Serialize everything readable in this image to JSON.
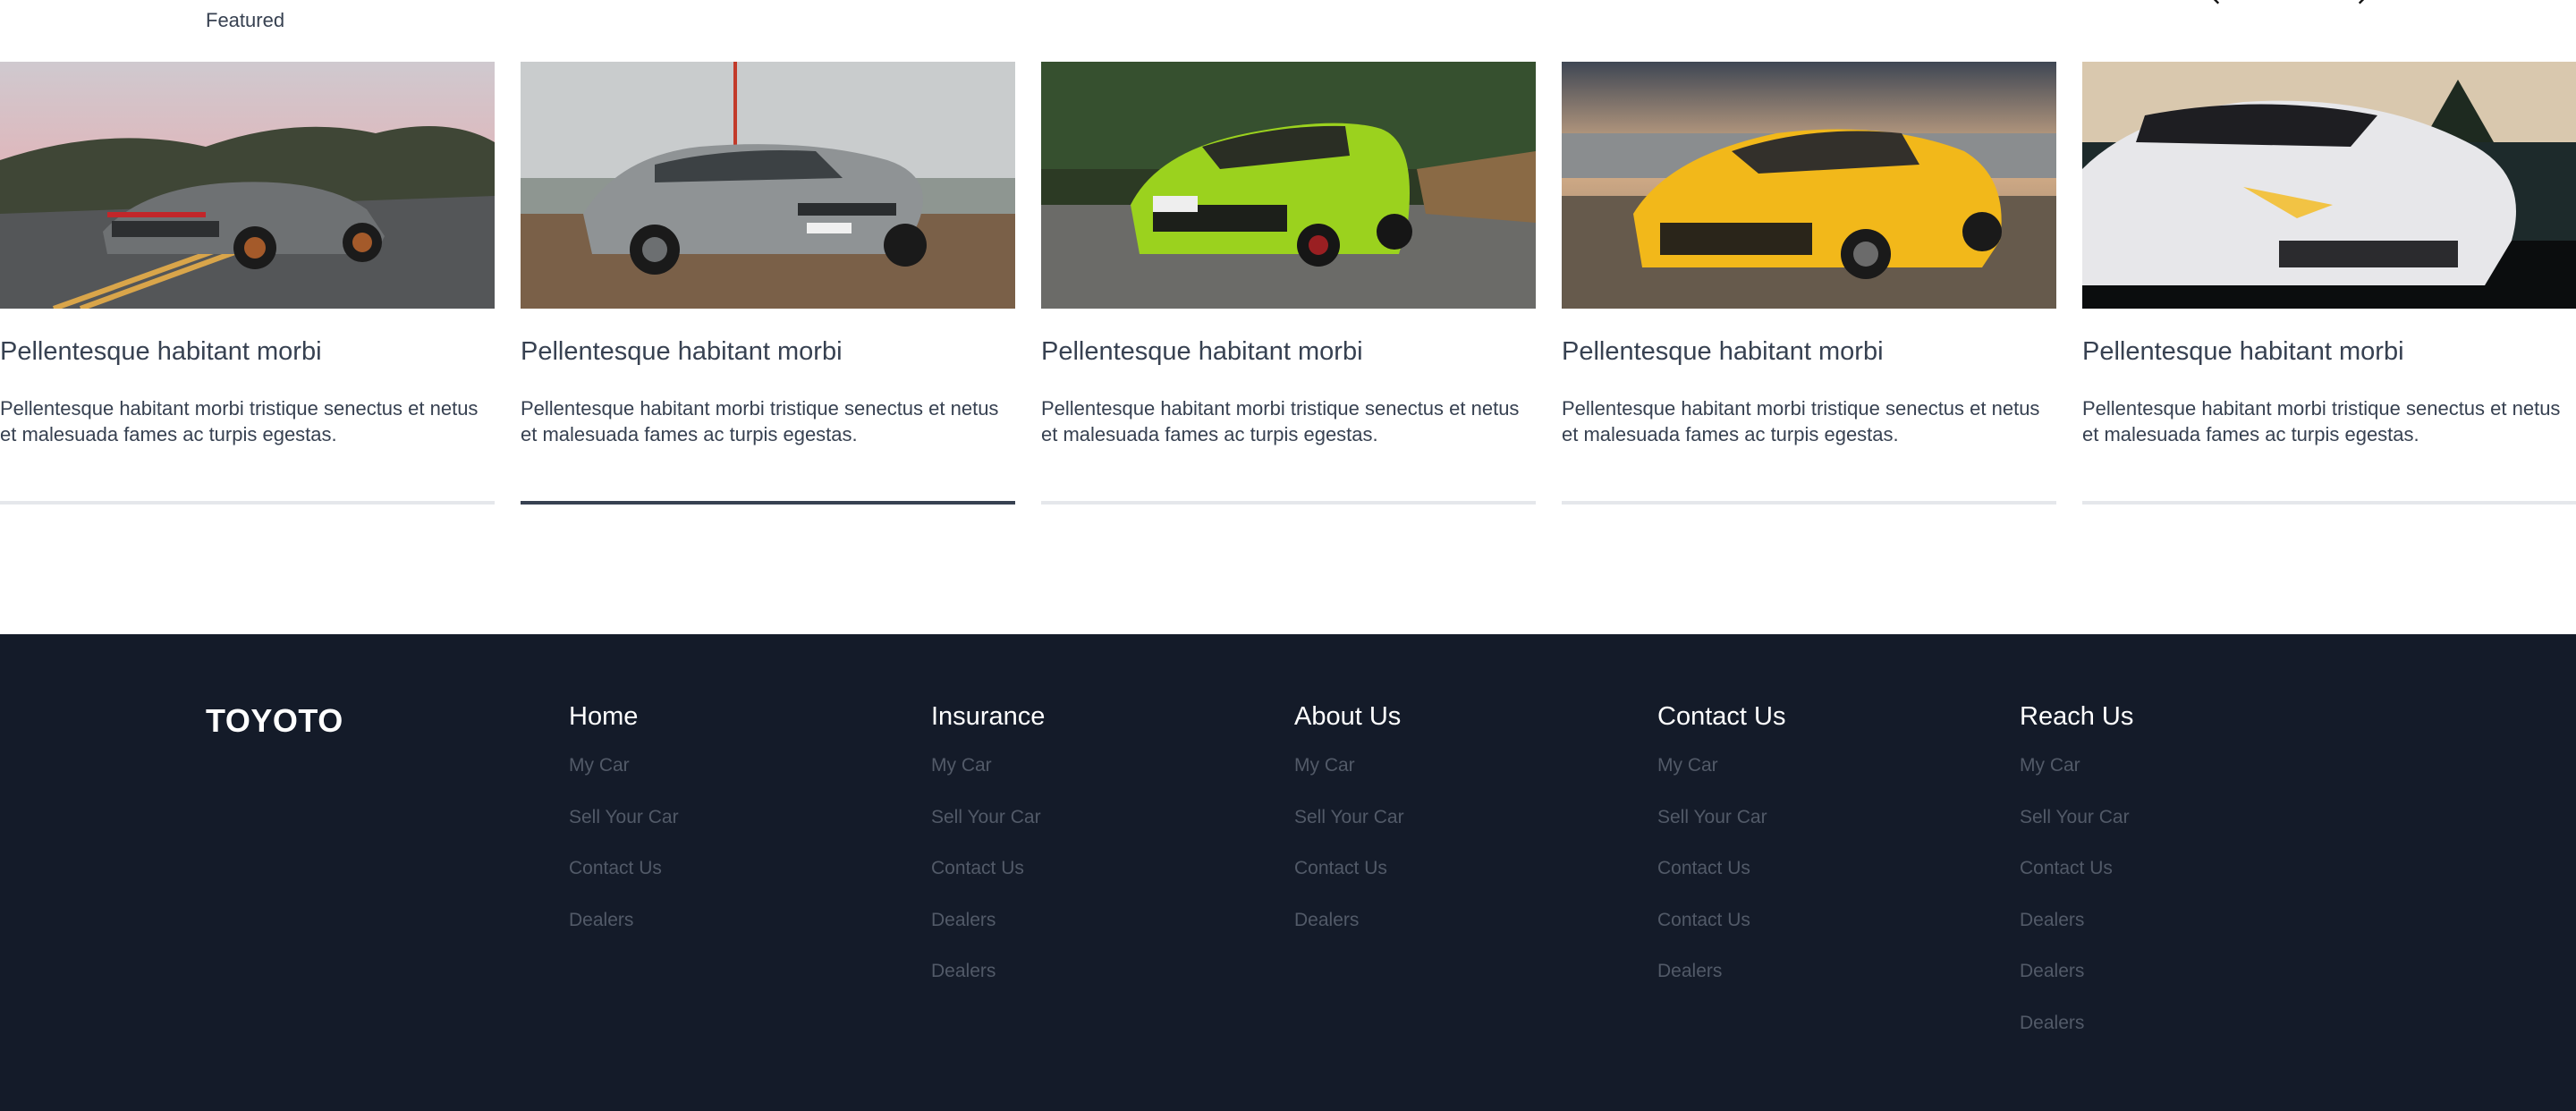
{
  "section": {
    "label": "Featured",
    "prev_icon": "chevron-left-icon",
    "next_icon": "chevron-right-icon"
  },
  "cards": [
    {
      "title": "Pellentesque habitant morbi",
      "description": "Pellentesque habitant morbi tristique senectus et netus et malesuada fames ac turpis egestas.",
      "image": "grey-sports-car-photo",
      "active": false
    },
    {
      "title": "Pellentesque habitant morbi",
      "description": "Pellentesque habitant morbi tristique senectus et netus et malesuada fames ac turpis egestas.",
      "image": "grey-sedan-photo",
      "active": true
    },
    {
      "title": "Pellentesque habitant morbi",
      "description": "Pellentesque habitant morbi tristique senectus et netus et malesuada fames ac turpis egestas.",
      "image": "lime-green-hatch-photo",
      "active": false
    },
    {
      "title": "Pellentesque habitant morbi",
      "description": "Pellentesque habitant morbi tristique senectus et netus et malesuada fames ac turpis egestas.",
      "image": "yellow-sports-car-photo",
      "active": false
    },
    {
      "title": "Pellentesque habitant morbi",
      "description": "Pellentesque habitant morbi tristique senectus et netus et malesuada fames ac turpis egestas.",
      "image": "white-supercar-photo",
      "active": false
    }
  ],
  "footer": {
    "brand": "TOYOTO",
    "columns": [
      {
        "title": "Home",
        "links": [
          "My Car",
          "Sell Your Car",
          "Contact Us",
          "Dealers"
        ]
      },
      {
        "title": "Insurance",
        "links": [
          "My Car",
          "Sell Your Car",
          "Contact Us",
          "Dealers",
          "Dealers"
        ]
      },
      {
        "title": "About Us",
        "links": [
          "My Car",
          "Sell Your Car",
          "Contact Us",
          "Dealers"
        ]
      },
      {
        "title": "Contact Us",
        "links": [
          "My Car",
          "Sell Your Car",
          "Contact Us",
          "Contact Us",
          "Dealers"
        ]
      },
      {
        "title": "Reach Us",
        "links": [
          "My Car",
          "Sell Your Car",
          "Contact Us",
          "Dealers",
          "Dealers",
          "Dealers"
        ]
      }
    ]
  },
  "colors": {
    "footer_bg": "#141b29",
    "footer_link": "#525a68",
    "active_rule": "#374151",
    "inactive_rule": "#e5e7eb"
  }
}
